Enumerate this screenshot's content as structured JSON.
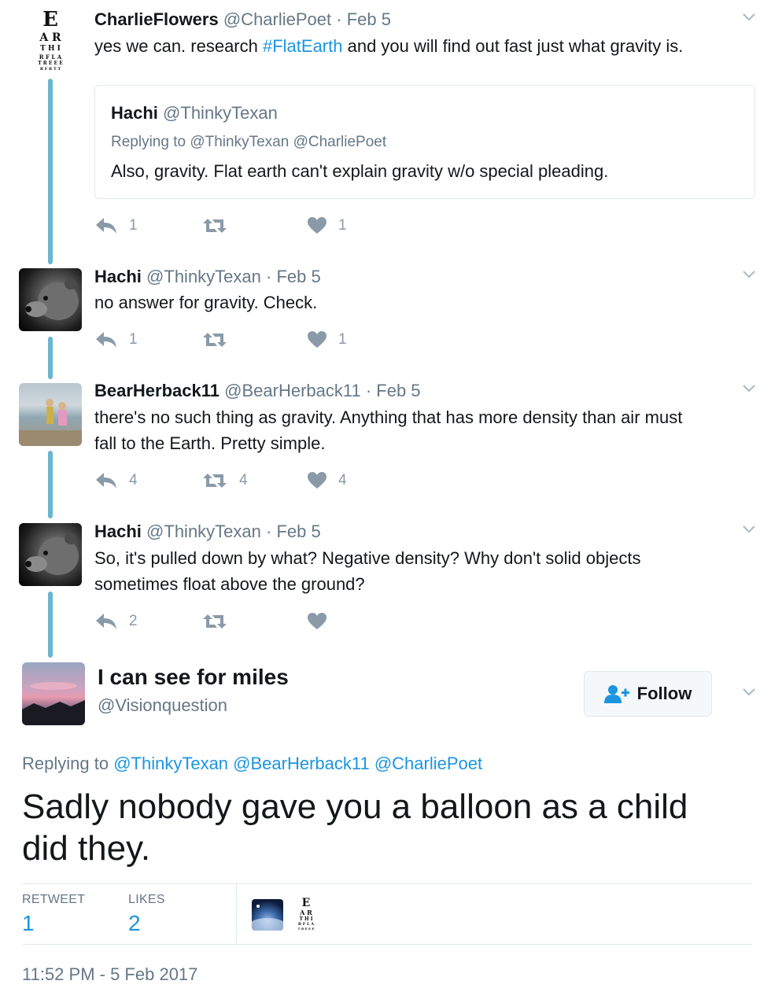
{
  "tweets": [
    {
      "name": "CharlieFlowers",
      "handle": "@CharliePoet",
      "time": "· Feb 5",
      "text_before": "yes we can. research ",
      "hashtag": "#FlatEarth",
      "text_after": " and you will find out fast just what gravity is.",
      "quote": {
        "name": "Hachi",
        "handle": "@ThinkyTexan",
        "replying_label": "Replying to",
        "replying_to": "@ThinkyTexan @CharliePoet",
        "text": "Also, gravity. Flat earth can't explain gravity w/o special pleading."
      },
      "replies": "1",
      "retweets": "",
      "likes": "1"
    },
    {
      "name": "Hachi",
      "handle": "@ThinkyTexan",
      "time": "· Feb 5",
      "text": "no answer for gravity. Check.",
      "replies": "1",
      "retweets": "",
      "likes": "1"
    },
    {
      "name": "BearHerback11",
      "handle": "@BearHerback11",
      "time": "· Feb 5",
      "text_line1": "there's no such thing as gravity. Anything that has more density than air must",
      "text_line2": "fall to the Earth. Pretty simple.",
      "replies": "4",
      "retweets": "4",
      "likes": "4"
    },
    {
      "name": "Hachi",
      "handle": "@ThinkyTexan",
      "time": "· Feb 5",
      "text_line1": "So, it's pulled down by what? Negative density? Why don't solid objects",
      "text_line2": "sometimes float above the ground?",
      "replies": "2",
      "retweets": "",
      "likes": ""
    }
  ],
  "main": {
    "name": "I can see for miles",
    "handle": "@Visionquestion",
    "follow_label": "Follow",
    "replying_label": "Replying to",
    "replying_to": "@ThinkyTexan @BearHerback11 @CharliePoet",
    "text_line1": "Sadly nobody gave you a balloon as a child",
    "text_line2": "did they.",
    "retweet_label": "RETWEET",
    "retweet_count": "1",
    "likes_label": "LIKES",
    "likes_count": "2",
    "timestamp": "11:52 PM - 5 Feb 2017"
  },
  "eyechart": {
    "row1": "E",
    "row2": "A R",
    "row3": "T H I",
    "row4": "R F L A",
    "row5": "T R E E E",
    "row6": "R F R T T"
  },
  "colors": {
    "link": "#1b95e0",
    "thread_line": "#6ab5cf",
    "icon": "#8a9aa8"
  },
  "icons": [
    "reply-icon",
    "retweet-icon",
    "heart-icon",
    "chevron-down-icon",
    "add-user-icon"
  ]
}
